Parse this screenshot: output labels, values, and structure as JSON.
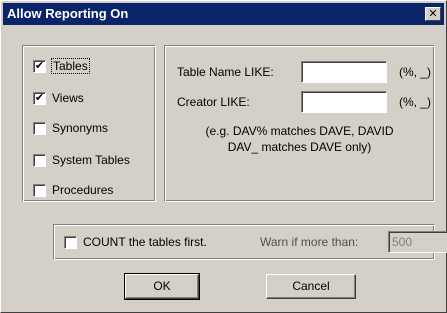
{
  "window": {
    "title": "Allow Reporting On",
    "close_glyph": "✕"
  },
  "object_types": [
    {
      "label": "Tables",
      "checked": true
    },
    {
      "label": "Views",
      "checked": true
    },
    {
      "label": "Synonyms",
      "checked": false
    },
    {
      "label": "System Tables",
      "checked": false
    },
    {
      "label": "Procedures",
      "checked": false
    }
  ],
  "filters": {
    "table_name_label": "Table Name LIKE:",
    "table_name_value": "",
    "table_name_hint": "(%, _)",
    "creator_label": "Creator LIKE:",
    "creator_value": "",
    "creator_hint": "(%, _)",
    "example_line1": "(e.g. DAV% matches DAVE, DAVID",
    "example_line2": "DAV_ matches DAVE only)"
  },
  "count": {
    "label": "COUNT the tables first.",
    "checked": false,
    "warn_label": "Warn if more than:",
    "warn_value": "500"
  },
  "buttons": {
    "ok": "OK",
    "cancel": "Cancel"
  }
}
